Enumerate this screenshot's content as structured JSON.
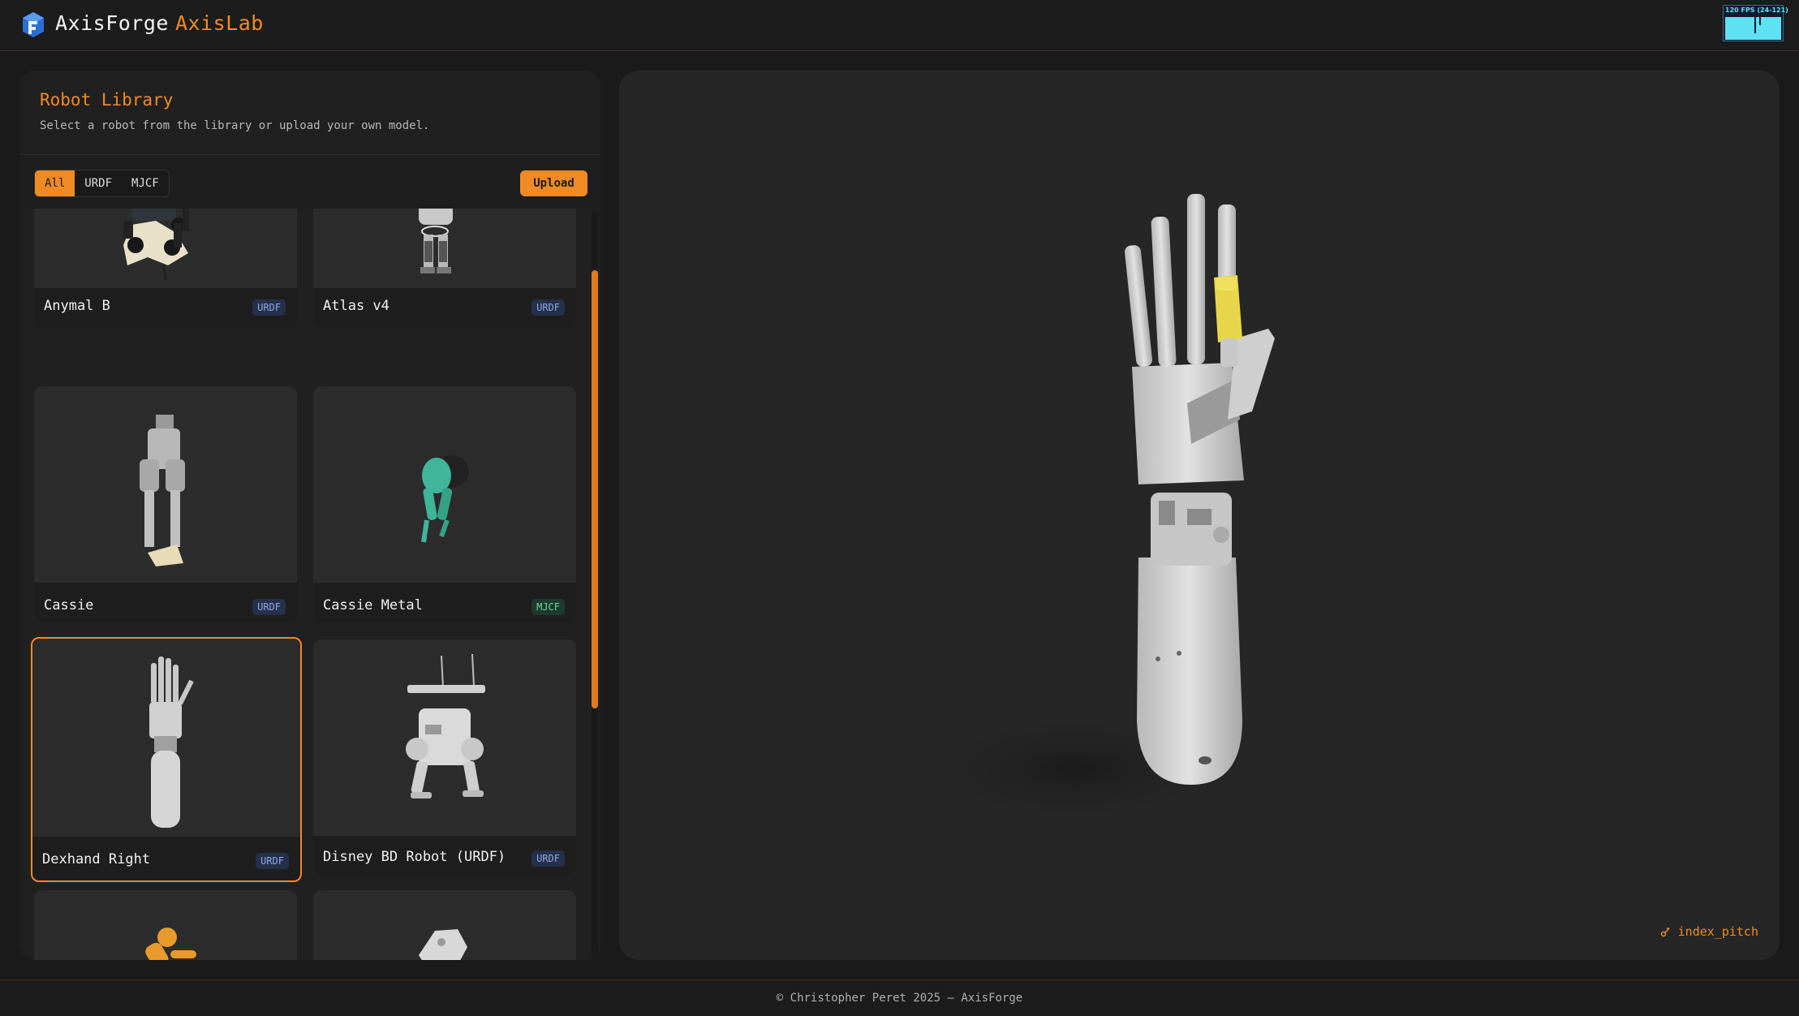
{
  "header": {
    "brand_primary": "AxisForge",
    "brand_secondary": "AxisLab",
    "fps_label": "120 FPS (24-121)",
    "accent_color": "#f08a24"
  },
  "library": {
    "title": "Robot Library",
    "subtitle": "Select a robot from the library or upload your own model.",
    "filters": [
      "All",
      "URDF",
      "MJCF"
    ],
    "active_filter": "All",
    "upload_label": "Upload",
    "robots": [
      {
        "name": "Anymal B",
        "format": "URDF"
      },
      {
        "name": "Atlas v4",
        "format": "URDF"
      },
      {
        "name": "Cassie",
        "format": "URDF"
      },
      {
        "name": "Cassie Metal",
        "format": "MJCF"
      },
      {
        "name": "Dexhand Right",
        "format": "URDF",
        "selected": true
      },
      {
        "name": "Disney BD Robot (URDF)",
        "format": "URDF"
      }
    ]
  },
  "viewer": {
    "selected_joint": "index_pitch",
    "joint_icon": "joint-icon"
  },
  "footer": {
    "text": "© Christopher Peret 2025 – AxisForge"
  }
}
